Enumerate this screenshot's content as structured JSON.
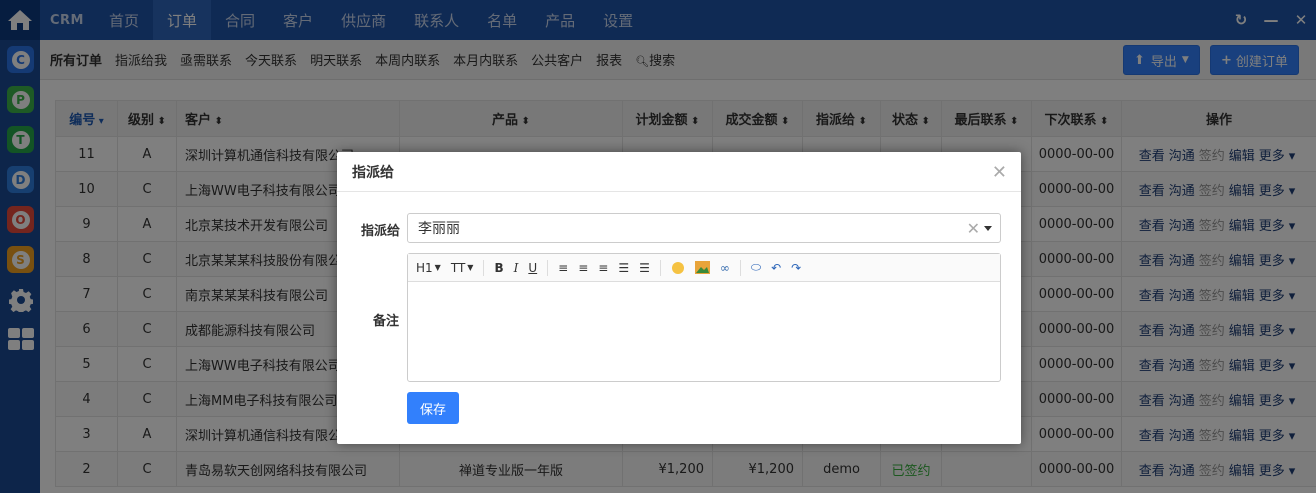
{
  "app": {
    "brand": "CRM",
    "nav": [
      "首页",
      "订单",
      "合同",
      "客户",
      "供应商",
      "联系人",
      "名单",
      "产品",
      "设置"
    ],
    "active_nav": "订单",
    "rail_apps": [
      {
        "letter": "C",
        "color": "#2a74e8"
      },
      {
        "letter": "P",
        "color": "#3cb44b"
      },
      {
        "letter": "T",
        "color": "#27a84a"
      },
      {
        "letter": "D",
        "color": "#2f7fe0"
      },
      {
        "letter": "O",
        "color": "#e84a3c"
      },
      {
        "letter": "S",
        "color": "#f0a020"
      }
    ]
  },
  "subnav": {
    "items": [
      "所有订单",
      "指派给我",
      "亟需联系",
      "今天联系",
      "明天联系",
      "本周内联系",
      "本月内联系",
      "公共客户",
      "报表",
      "搜索"
    ],
    "export_label": "导出",
    "create_label": "创建订单"
  },
  "table": {
    "headers": [
      "编号",
      "级别",
      "客户",
      "产品",
      "计划金额",
      "成交金额",
      "指派给",
      "状态",
      "最后联系",
      "下次联系",
      "操作"
    ],
    "ops": [
      "查看",
      "沟通",
      "签约",
      "编辑",
      "更多"
    ],
    "rows": [
      {
        "id": "11",
        "level": "A",
        "customer": "深圳计算机通信科技有限公司",
        "product": "",
        "plan": "",
        "deal": "",
        "assignee": "",
        "status": "",
        "last": "",
        "next": "0000-00-00"
      },
      {
        "id": "10",
        "level": "C",
        "customer": "上海WW电子科技有限公司",
        "product": "",
        "plan": "",
        "deal": "",
        "assignee": "",
        "status": "",
        "last": "",
        "next": "0000-00-00"
      },
      {
        "id": "9",
        "level": "A",
        "customer": "北京某技术开发有限公司",
        "product": "",
        "plan": "",
        "deal": "",
        "assignee": "",
        "status": "",
        "last": "",
        "next": "0000-00-00"
      },
      {
        "id": "8",
        "level": "C",
        "customer": "北京某某某科技股份有限公司",
        "product": "",
        "plan": "",
        "deal": "",
        "assignee": "",
        "status": "",
        "last": "",
        "next": "0000-00-00"
      },
      {
        "id": "7",
        "level": "C",
        "customer": "南京某某某科技有限公司",
        "product": "",
        "plan": "",
        "deal": "",
        "assignee": "",
        "status": "",
        "last": "",
        "next": "0000-00-00"
      },
      {
        "id": "6",
        "level": "C",
        "customer": "成都能源科技有限公司",
        "product": "",
        "plan": "",
        "deal": "",
        "assignee": "",
        "status": "",
        "last": "",
        "next": "0000-00-00"
      },
      {
        "id": "5",
        "level": "C",
        "customer": "上海WW电子科技有限公司",
        "product": "",
        "plan": "",
        "deal": "",
        "assignee": "",
        "status": "",
        "last": "",
        "next": "0000-00-00"
      },
      {
        "id": "4",
        "level": "C",
        "customer": "上海MM电子科技有限公司",
        "product": "",
        "plan": "",
        "deal": "",
        "assignee": "",
        "status": "",
        "last": "",
        "next": "0000-00-00"
      },
      {
        "id": "3",
        "level": "A",
        "customer": "深圳计算机通信科技有限公司",
        "product": "",
        "plan": "",
        "deal": "",
        "assignee": "",
        "status": "",
        "last": "",
        "next": "0000-00-00"
      },
      {
        "id": "2",
        "level": "C",
        "customer": "青岛易软天创网络科技有限公司",
        "product": "禅道专业版一年版",
        "plan": "¥1,200",
        "deal": "¥1,200",
        "assignee": "demo",
        "status": "已签约",
        "last": "",
        "next": "0000-00-00"
      }
    ]
  },
  "modal": {
    "title": "指派给",
    "assign_label": "指派给",
    "assign_value": "李丽丽",
    "note_label": "备注",
    "save_label": "保存",
    "toolbar": [
      "H1",
      "TT",
      "B",
      "I",
      "U"
    ]
  }
}
